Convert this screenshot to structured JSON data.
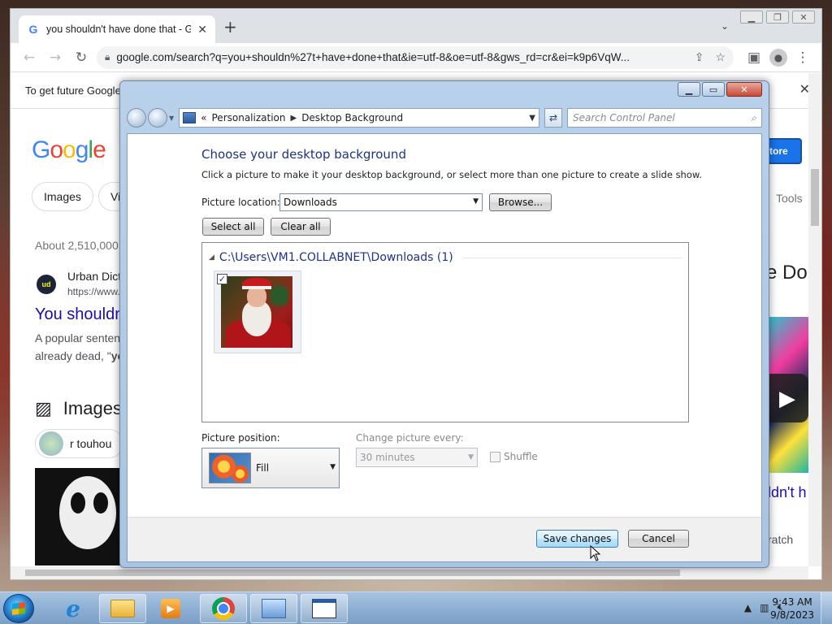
{
  "browser": {
    "tab_title": "you shouldn't have done that - G",
    "tab_favicon": "G",
    "new_tab": "+",
    "url": "google.com/search?q=you+shouldn%27t+have+done+that&ie=utf-8&oe=utf-8&gws_rd=cr&ei=k9p6VqW..."
  },
  "google_page": {
    "infobar_text": "To get future Google",
    "logo": [
      "G",
      "o",
      "o",
      "g",
      "l",
      "e"
    ],
    "chip_images": "Images",
    "chip_videos": "Vi",
    "results_count": "About 2,510,000",
    "site_icon_text": "ud",
    "site_name": "Urban Dict",
    "site_url": "https://www.",
    "result_title": "You shouldn",
    "snippet1": "A popular senten",
    "snippet2_prefix": "already dead, \"",
    "snippet2_bold": "yo",
    "images_heading": "Images",
    "image_chip": "r touhou",
    "store_button": "tore",
    "tools": "Tools",
    "right_title": "e Do",
    "right_link": "ldn't h",
    "right_snippet": "ratch"
  },
  "dialog": {
    "breadcrumb_root": "Personalization",
    "breadcrumb_current": "Desktop Background",
    "breadcrumb_prefix": "«",
    "search_placeholder": "Search Control Panel",
    "title": "Choose your desktop background",
    "description": "Click a picture to make it your desktop background, or select more than one picture to create a slide show.",
    "picture_location_label": "Picture location:",
    "picture_location_value": "Downloads",
    "browse_button": "Browse...",
    "select_all_button": "Select all",
    "clear_all_button": "Clear all",
    "group_header": "C:\\Users\\VM1.COLLABNET\\Downloads (1)",
    "thumbnail_checked": "✓",
    "picture_position_label": "Picture position:",
    "picture_position_value": "Fill",
    "change_every_label": "Change picture every:",
    "change_every_value": "30 minutes",
    "shuffle_label": "Shuffle",
    "save_button": "Save changes",
    "cancel_button": "Cancel"
  },
  "taskbar": {
    "time": "9:43 AM",
    "date": "9/8/2023"
  }
}
